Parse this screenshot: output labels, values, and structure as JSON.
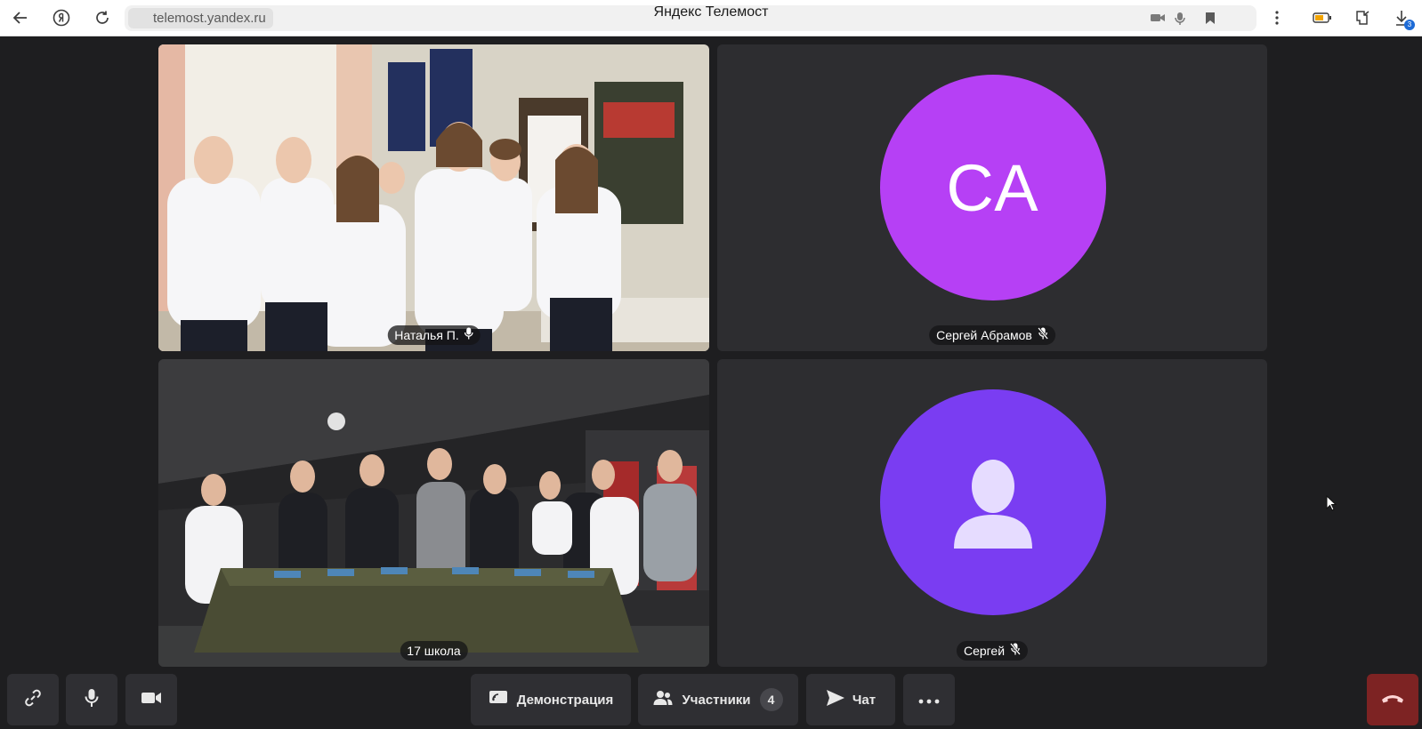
{
  "browser": {
    "url": "telemost.yandex.ru",
    "title": "Яндекс Телемост",
    "downloads_badge": "3"
  },
  "tiles": [
    {
      "name": "Наталья П.",
      "mic": "on",
      "has_video": true
    },
    {
      "name": "Сергей Абрамов",
      "mic": "muted",
      "has_video": false,
      "initials": "СА"
    },
    {
      "name": "17 школа",
      "has_video": true
    },
    {
      "name": "Сергей",
      "mic": "muted",
      "has_video": false
    }
  ],
  "toolbar": {
    "demo_label": "Демонстрация",
    "participants_label": "Участники",
    "participants_count": "4",
    "chat_label": "Чат"
  },
  "colors": {
    "avatar_ca": "#b640f5",
    "avatar_default": "#7a3df2",
    "hangup": "#7d2323",
    "background": "#1e1e20"
  }
}
